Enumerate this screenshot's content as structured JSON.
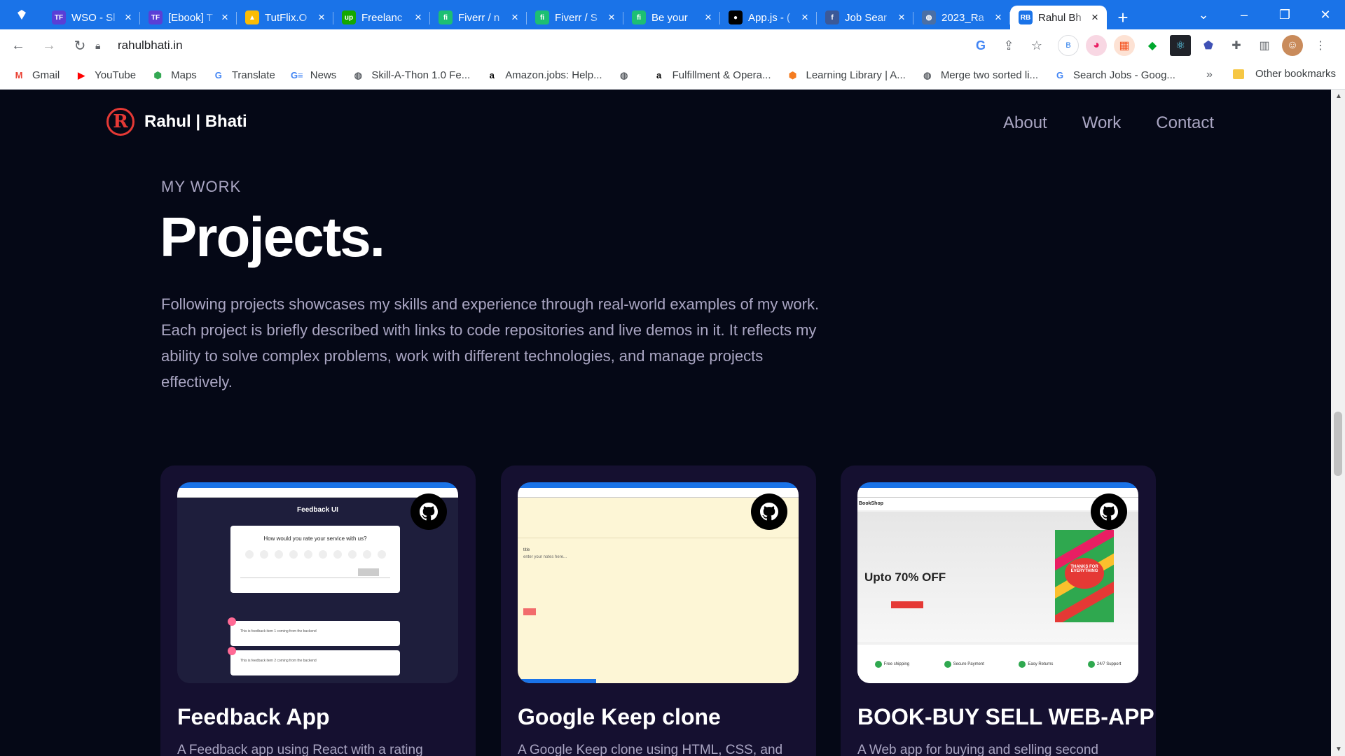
{
  "browser": {
    "tabs": [
      {
        "title": "WSO - Sl",
        "favicon": "TF",
        "color": "#5a3fd6"
      },
      {
        "title": "[Ebook] T",
        "favicon": "TF",
        "color": "#5a3fd6"
      },
      {
        "title": "TutFlix.O",
        "favicon": "drive",
        "color": "#fbbc04"
      },
      {
        "title": "Freelanc",
        "favicon": "up",
        "color": "#14a800"
      },
      {
        "title": "Fiverr / n",
        "favicon": "fi",
        "color": "#1dbf73"
      },
      {
        "title": "Fiverr / S",
        "favicon": "fi",
        "color": "#1dbf73"
      },
      {
        "title": "Be your",
        "favicon": "fi",
        "color": "#1dbf73"
      },
      {
        "title": "App.js - (",
        "favicon": "github",
        "color": "#000000"
      },
      {
        "title": "Job Sear",
        "favicon": "f",
        "color": "#3b5998"
      },
      {
        "title": "2023_Ra",
        "favicon": "globe",
        "color": "#4a6fa5"
      },
      {
        "title": "Rahul Bh",
        "favicon": "RB",
        "color": "#1a73e8",
        "active": true
      }
    ],
    "url": "rahulbhati.in",
    "bookmarks": [
      {
        "label": "Gmail",
        "icon": "gmail-icon",
        "glyph": "M",
        "color": "#ea4335"
      },
      {
        "label": "YouTube",
        "icon": "youtube-icon",
        "glyph": "▶",
        "color": "#ff0000"
      },
      {
        "label": "Maps",
        "icon": "maps-icon",
        "glyph": "⬢",
        "color": "#34a853"
      },
      {
        "label": "Translate",
        "icon": "translate-icon",
        "glyph": "G",
        "color": "#4285f4"
      },
      {
        "label": "News",
        "icon": "news-icon",
        "glyph": "G≡",
        "color": "#4285f4"
      },
      {
        "label": "Skill-A-Thon 1.0 Fe...",
        "icon": "globe-icon",
        "glyph": "◍",
        "color": "#5f6368"
      },
      {
        "label": "Amazon.jobs: Help...",
        "icon": "amazon-icon",
        "glyph": "a",
        "color": "#000000"
      },
      {
        "label": "",
        "icon": "globe-icon",
        "glyph": "◍",
        "color": "#5f6368"
      },
      {
        "label": "Fulfillment & Opera...",
        "icon": "amazon-icon",
        "glyph": "a",
        "color": "#000000"
      },
      {
        "label": "Learning Library | A...",
        "icon": "box-icon",
        "glyph": "⬢",
        "color": "#f47c20"
      },
      {
        "label": "Merge two sorted li...",
        "icon": "globe-icon",
        "glyph": "◍",
        "color": "#5f6368"
      },
      {
        "label": "Search Jobs - Goog...",
        "icon": "google-icon",
        "glyph": "G",
        "color": "#4285f4"
      }
    ],
    "bookmarks_more": "»",
    "other_bookmarks": "Other bookmarks"
  },
  "site": {
    "logo_letter": "R",
    "logo_text": "Rahul | Bhati",
    "nav": [
      "About",
      "Work",
      "Contact"
    ],
    "subtitle": "MY WORK",
    "heading": "Projects.",
    "intro": "Following projects showcases my skills and experience through real-world examples of my work. Each project is briefly described with links to code repositories and live demos in it. It reflects my ability to solve complex problems, work with different technologies, and manage projects effectively."
  },
  "projects": [
    {
      "title": "Feedback App",
      "description": "A Feedback app using React with a rating",
      "preview": {
        "title": "Feedback UI",
        "question": "How would you rate your service with us?",
        "review_1": "This is feedback item 1 coming from the backend",
        "review_2": "This is feedback item 2 coming from the backend"
      }
    },
    {
      "title": "Google Keep clone",
      "description": "A Google Keep clone using HTML, CSS, and",
      "preview": {
        "note_title": "title",
        "note_body": "enter your notes here..."
      }
    },
    {
      "title": "BOOK-BUY SELL WEB-APP",
      "description": "A Web app for buying and selling second",
      "preview": {
        "brand": "BookShop",
        "offer": "Upto 70% OFF",
        "book_text": "THANKS FOR EVERYTHING",
        "features": [
          "Free shipping",
          "Secure Payment",
          "Easy Returns",
          "24/7 Support"
        ]
      }
    }
  ],
  "colors": {
    "page_bg": "#050816",
    "card_bg": "#151030",
    "secondary_text": "#aaa6c3",
    "tab_bar": "#1a73e8",
    "logo_red": "#e53935"
  }
}
